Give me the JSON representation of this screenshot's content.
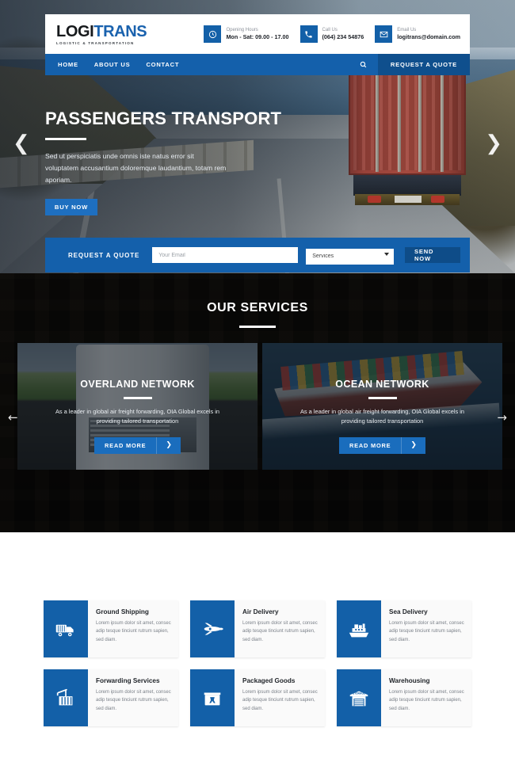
{
  "header": {
    "logo": {
      "part1": "LOGI",
      "part2": "TRANS",
      "tagline": "LOGISTIC & TRANSPORTATION"
    },
    "contacts": [
      {
        "icon": "clock-icon",
        "label": "Opening Hours",
        "value": "Mon - Sat: 09.00 - 17.00"
      },
      {
        "icon": "phone-icon",
        "label": "Call Us",
        "value": "(064) 234 54876"
      },
      {
        "icon": "envelope-icon",
        "label": "Email Us",
        "value": "logitrans@domain.com"
      }
    ]
  },
  "nav": {
    "links": [
      {
        "label": "HOME"
      },
      {
        "label": "ABOUT US"
      },
      {
        "label": "CONTACT"
      }
    ],
    "search_icon": "search-icon",
    "cta": "REQUEST A QUOTE"
  },
  "hero": {
    "title": "PASSENGERS TRANSPORT",
    "description": "Sed ut perspiciatis unde omnis iste natus error sit voluptatem accusantium doloremque laudantium, totam rem aporiam.",
    "button": "BUY NOW",
    "prev_icon": "chevron-left-icon",
    "next_icon": "chevron-right-icon"
  },
  "quote": {
    "label": "REQUEST A QUOTE",
    "email_placeholder": "Your Email",
    "email_value": "",
    "service_selected": "Services",
    "service_options": [
      "Services"
    ],
    "button": "SEND NOW"
  },
  "services": {
    "title": "OUR SERVICES",
    "prev_icon": "arrow-left-icon",
    "next_icon": "arrow-right-icon",
    "cards": [
      {
        "title": "OVERLAND NETWORK",
        "description": "As a leader in global air freight forwarding, OIA Global excels in providing tailored transportation",
        "button": "READ MORE",
        "chevron": "chevron-right-icon"
      },
      {
        "title": "OCEAN NETWORK",
        "description": "As a leader in global air freight forwarding, OIA Global excels in providing tailored transportation",
        "button": "READ MORE",
        "chevron": "chevron-right-icon"
      }
    ]
  },
  "features": [
    {
      "icon": "truck-icon",
      "title": "Ground Shipping",
      "description": "Lorem ipsum dolor sit amet, consec adip tesque tinciunt rutrum sapien, sed diam."
    },
    {
      "icon": "airplane-icon",
      "title": "Air Delivery",
      "description": "Lorem ipsum dolor sit amet, consec adip tesque tinciunt rutrum sapien, sed diam."
    },
    {
      "icon": "ship-icon",
      "title": "Sea Delivery",
      "description": "Lorem ipsum dolor sit amet, consec adip tesque tinciunt rutrum sapien, sed diam."
    },
    {
      "icon": "crane-icon",
      "title": "Forwarding Services",
      "description": "Lorem ipsum dolor sit amet, consec adip tesque tinciunt rutrum sapien, sed diam."
    },
    {
      "icon": "fragile-box-icon",
      "title": "Packaged Goods",
      "description": "Lorem ipsum dolor sit amet, consec adip tesque tinciunt rutrum sapien, sed diam."
    },
    {
      "icon": "warehouse-icon",
      "title": "Warehousing",
      "description": "Lorem ipsum dolor sit amet, consec adip tesque tinciunt rutrum sapien, sed diam."
    }
  ],
  "colors": {
    "primary": "#1360a8",
    "nav": "#1460ab",
    "cta_dark": "#0f4f8d",
    "button": "#1e6fc0"
  }
}
